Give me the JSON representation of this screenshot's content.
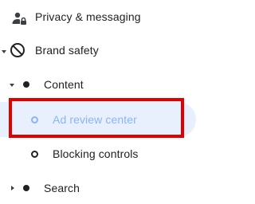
{
  "nav": {
    "items": [
      {
        "label": "Privacy & messaging",
        "icon": "person-lock-icon"
      },
      {
        "label": "Brand safety",
        "icon": "block-icon",
        "expanded": true
      },
      {
        "label": "Content",
        "expanded": true
      },
      {
        "label": "Ad review center",
        "active": true
      },
      {
        "label": "Blocking controls"
      },
      {
        "label": "Search",
        "expanded": false
      }
    ]
  },
  "colors": {
    "active_text": "#8ab4f8",
    "active_bg": "#e8f0fe",
    "highlight_border": "#e00000",
    "text": "#202124"
  }
}
